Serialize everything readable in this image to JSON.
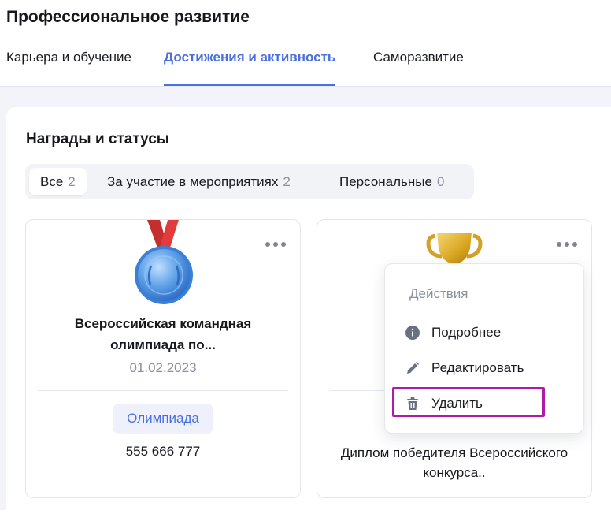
{
  "page": {
    "title": "Профессиональное развитие"
  },
  "tabs": [
    {
      "label": "Карьера и обучение",
      "active": false
    },
    {
      "label": "Достижения и активность",
      "active": true
    },
    {
      "label": "Саморазвитие",
      "active": false
    }
  ],
  "awards": {
    "title": "Награды и статусы",
    "filters": [
      {
        "label": "Все",
        "count": "2",
        "active": true
      },
      {
        "label": "За участие в мероприятиях",
        "count": "2",
        "active": false
      },
      {
        "label": "Персональные",
        "count": "0",
        "active": false
      }
    ],
    "cards": [
      {
        "icon": "medal-icon",
        "title": "Всероссийская командная олимпиада по...",
        "date": "01.02.2023",
        "tag": "Олимпиада",
        "number": "555 666 777"
      },
      {
        "icon": "trophy-icon",
        "text": "Диплом победителя Всероссийского конкурса.."
      }
    ]
  },
  "actions_menu": {
    "header": "Действия",
    "items": [
      {
        "label": "Подробнее",
        "icon": "info-icon"
      },
      {
        "label": "Редактировать",
        "icon": "pencil-icon"
      },
      {
        "label": "Удалить",
        "icon": "trash-icon",
        "highlighted": true
      }
    ]
  },
  "colors": {
    "accent": "#4a6fe0",
    "highlight": "#b01aa6",
    "muted": "#8a8f9e"
  }
}
